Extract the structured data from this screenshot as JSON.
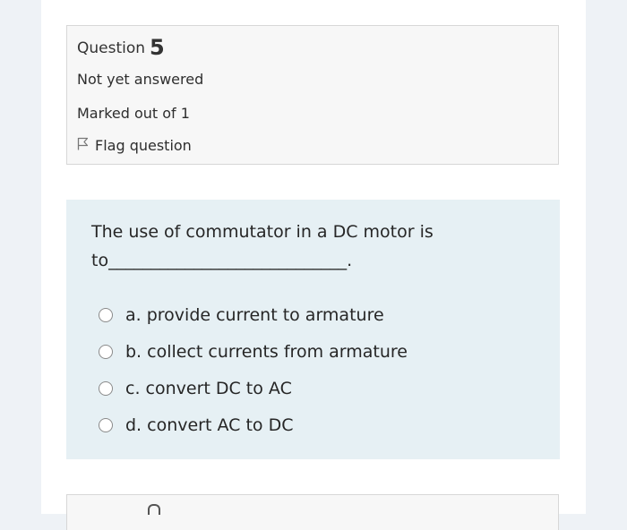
{
  "question_info": {
    "label": "Question",
    "number": "5",
    "state": "Not yet answered",
    "grade": "Marked out of 1",
    "flag_label": "Flag question",
    "flag_icon": "flag-outline-icon"
  },
  "question": {
    "text": "The use of commutator in a DC motor is to____________________________.",
    "options": [
      {
        "label": "a. provide current to armature",
        "selected": false
      },
      {
        "label": "b. collect currents from armature",
        "selected": false
      },
      {
        "label": "c. convert DC to AC",
        "selected": false
      },
      {
        "label": "d. convert AC to DC",
        "selected": false
      }
    ]
  },
  "colors": {
    "page_bg": "#eef2f6",
    "info_bg": "#f7f7f7",
    "formulation_bg": "#e6f0f4"
  }
}
